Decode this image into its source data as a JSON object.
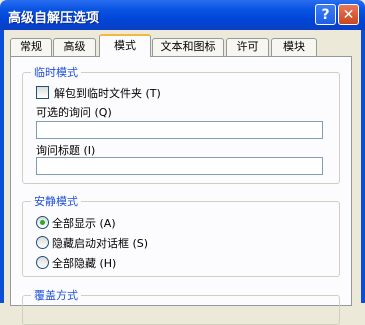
{
  "window": {
    "title": "高级自解压选项",
    "help_label": "?",
    "close_label": "✕"
  },
  "tabs": [
    {
      "label": "常规",
      "active": false
    },
    {
      "label": "高级",
      "active": false
    },
    {
      "label": "模式",
      "active": true
    },
    {
      "label": "文本和图标",
      "active": false
    },
    {
      "label": "许可",
      "active": false
    },
    {
      "label": "模块",
      "active": false
    }
  ],
  "temp_mode": {
    "legend": "临时模式",
    "unpack_to_temp": {
      "label": "解包到临时文件夹 (T)",
      "checked": false
    },
    "optional_query": {
      "label": "可选的询问 (Q)",
      "value": ""
    },
    "query_title": {
      "label": "询问标题 (I)",
      "value": ""
    }
  },
  "silent_mode": {
    "legend": "安静模式",
    "options": [
      {
        "label": "全部显示 (A)",
        "selected": true
      },
      {
        "label": "隐藏启动对话框 (S)",
        "selected": false
      },
      {
        "label": "全部隐藏 (H)",
        "selected": false
      }
    ]
  },
  "overwrite_mode": {
    "legend": "覆盖方式"
  }
}
